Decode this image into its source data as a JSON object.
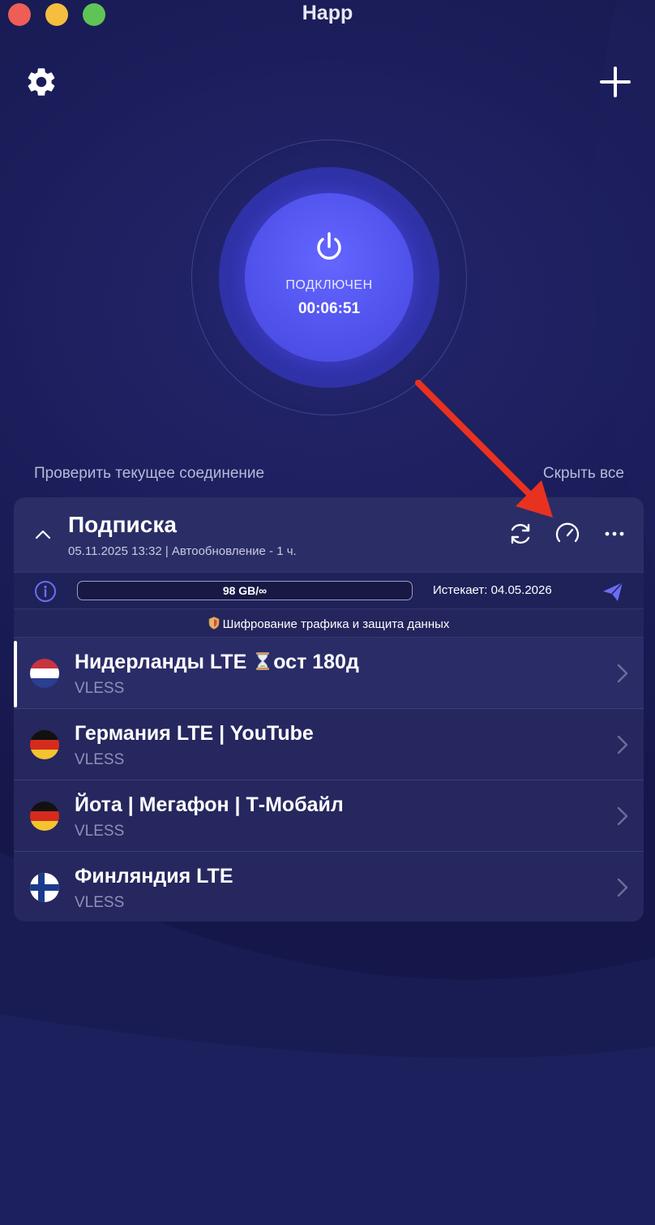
{
  "window": {
    "title": "Happ"
  },
  "icons": {
    "settings": "gear-icon",
    "add": "plus-icon",
    "power": "power-icon",
    "collapse": "chevron-up-icon",
    "refresh": "refresh-icon",
    "speedtest": "speedometer-icon",
    "more": "more-dots-icon",
    "info": "info-icon",
    "telegram": "send-icon"
  },
  "connection": {
    "status": "ПОДКЛЮЧЕН",
    "timer": "00:06:51"
  },
  "links": {
    "check": "Проверить текущее соединение",
    "hide_all": "Скрыть все"
  },
  "subscription": {
    "title": "Подписка",
    "meta": "05.11.2025 13:32 | Автообновление - 1 ч.",
    "quota_text": "98 GB/∞",
    "quota_fill_percent": 0,
    "expires": "Истекает: 04.05.2026",
    "banner": "Шифрование трафика и защита данных"
  },
  "servers": [
    {
      "name_a": "Нидерланды LTE",
      "name_b": "ост 180д",
      "protocol": "VLESS",
      "flag": "NL",
      "selected": true
    },
    {
      "name": "Германия LTE | YouTube",
      "protocol": "VLESS",
      "flag": "DE",
      "selected": false
    },
    {
      "name": "Йота | Мегафон | Т-Мобайл",
      "protocol": "VLESS",
      "flag": "DE",
      "selected": false
    },
    {
      "name": "Финляндия LTE",
      "protocol": "VLESS",
      "flag": "FI",
      "selected": false
    }
  ],
  "colors": {
    "background": "#181a52",
    "accent": "#5052ec",
    "card": "#25275e",
    "annotation_arrow": "#e8321f"
  }
}
